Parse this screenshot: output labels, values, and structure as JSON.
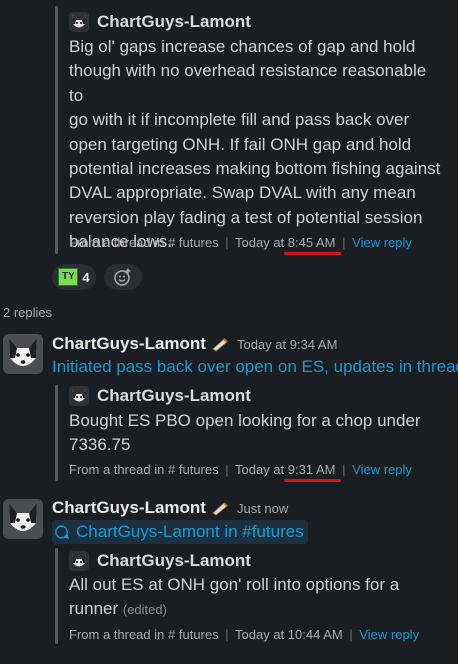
{
  "msg1": {
    "quote_author": "ChartGuys-Lamont",
    "quote_lines": [
      "Big ol' gaps increase chances of gap and hold",
      "though with no overhead resistance reasonable to",
      "go with it if incomplete fill and pass back over",
      "open targeting ONH. If fail ONH gap and hold",
      "potential increases making bottom fishing against",
      "DVAL appropriate. Swap DVAL with any mean",
      "reversion play fading a test of potential session",
      "balance lows."
    ],
    "meta_from": "From a thread in",
    "meta_hash": "#",
    "meta_channel": "futures",
    "meta_sep": "|",
    "meta_today": "Today at",
    "meta_time": "8:45 AM",
    "meta_view": "View reply"
  },
  "reactions": {
    "emoji_label": "TY",
    "count": "4"
  },
  "thread": {
    "replies_label": "2 replies"
  },
  "msg2": {
    "username": "ChartGuys-Lamont",
    "time": "Today at 9:34 AM",
    "text": "Initiated pass back over open on ES, updates in thread",
    "quote_author": "ChartGuys-Lamont",
    "quote_lines": [
      "Bought ES PBO open looking for a chop under",
      "7336.75"
    ],
    "meta_from": "From a thread in",
    "meta_hash": "#",
    "meta_channel": "futures",
    "meta_sep": "|",
    "meta_today": "Today at",
    "meta_time": "9:31 AM",
    "meta_view": "View reply"
  },
  "msg3": {
    "username": "ChartGuys-Lamont",
    "time": "Just now",
    "chip_text": "ChartGuys-Lamont in #futures",
    "quote_author": "ChartGuys-Lamont",
    "quote_lines": [
      "All out ES at ONH gon' roll into options for a"
    ],
    "quote_last": "runner",
    "edited": "(edited)",
    "meta_from": "From a thread in",
    "meta_hash": "#",
    "meta_channel": "futures",
    "meta_sep": "|",
    "meta_today": "Today at 10:44 AM",
    "meta_view": "View reply"
  },
  "colors": {
    "background": "#1a1d21",
    "link": "#1d9bd1",
    "underline": "#d0161c",
    "quote_bar": "#5a5c60"
  },
  "icons": {
    "avatar": "husky-dog-avatar",
    "status": "joint-emoji",
    "add_reaction": "add-emoji-icon",
    "chip": "speech-bubble-icon"
  }
}
